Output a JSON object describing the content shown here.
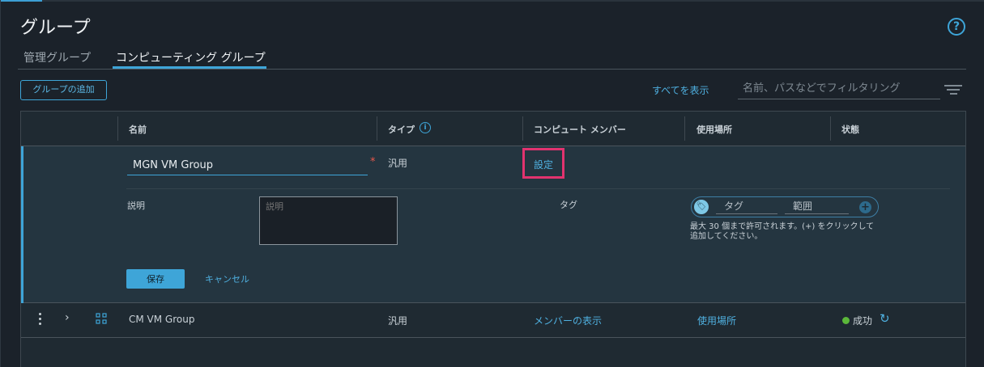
{
  "header": {
    "title": "グループ",
    "help_icon": "?"
  },
  "tabs": [
    {
      "label": "管理グループ",
      "active": false
    },
    {
      "label": "コンピューティング グループ",
      "active": true
    }
  ],
  "toolbar": {
    "add_group": "グループの追加",
    "show_all": "すべてを表示",
    "filter_placeholder": "名前、パスなどでフィルタリング"
  },
  "table": {
    "columns": [
      "名前",
      "タイプ",
      "コンピュート メンバー",
      "使用場所",
      "状態"
    ],
    "edit_row": {
      "name_value": "MGN VM Group",
      "required_mark": "*",
      "type": "汎用",
      "members_link": "設定",
      "description_label": "説明",
      "description_placeholder": "説明",
      "tag_label": "タグ",
      "tag_placeholder": "タグ",
      "scope_placeholder": "範囲",
      "tag_hint": "最大 30 個まで許可されます。(+) をクリックして追加してください。",
      "save": "保存",
      "cancel": "キャンセル"
    },
    "rows": [
      {
        "name": "CM VM Group",
        "type": "汎用",
        "members": "メンバーの表示",
        "where_used": "使用場所",
        "status": "成功"
      }
    ]
  },
  "colors": {
    "accent": "#3ea5d8",
    "highlight": "#e2336f",
    "success": "#5bb83a"
  }
}
